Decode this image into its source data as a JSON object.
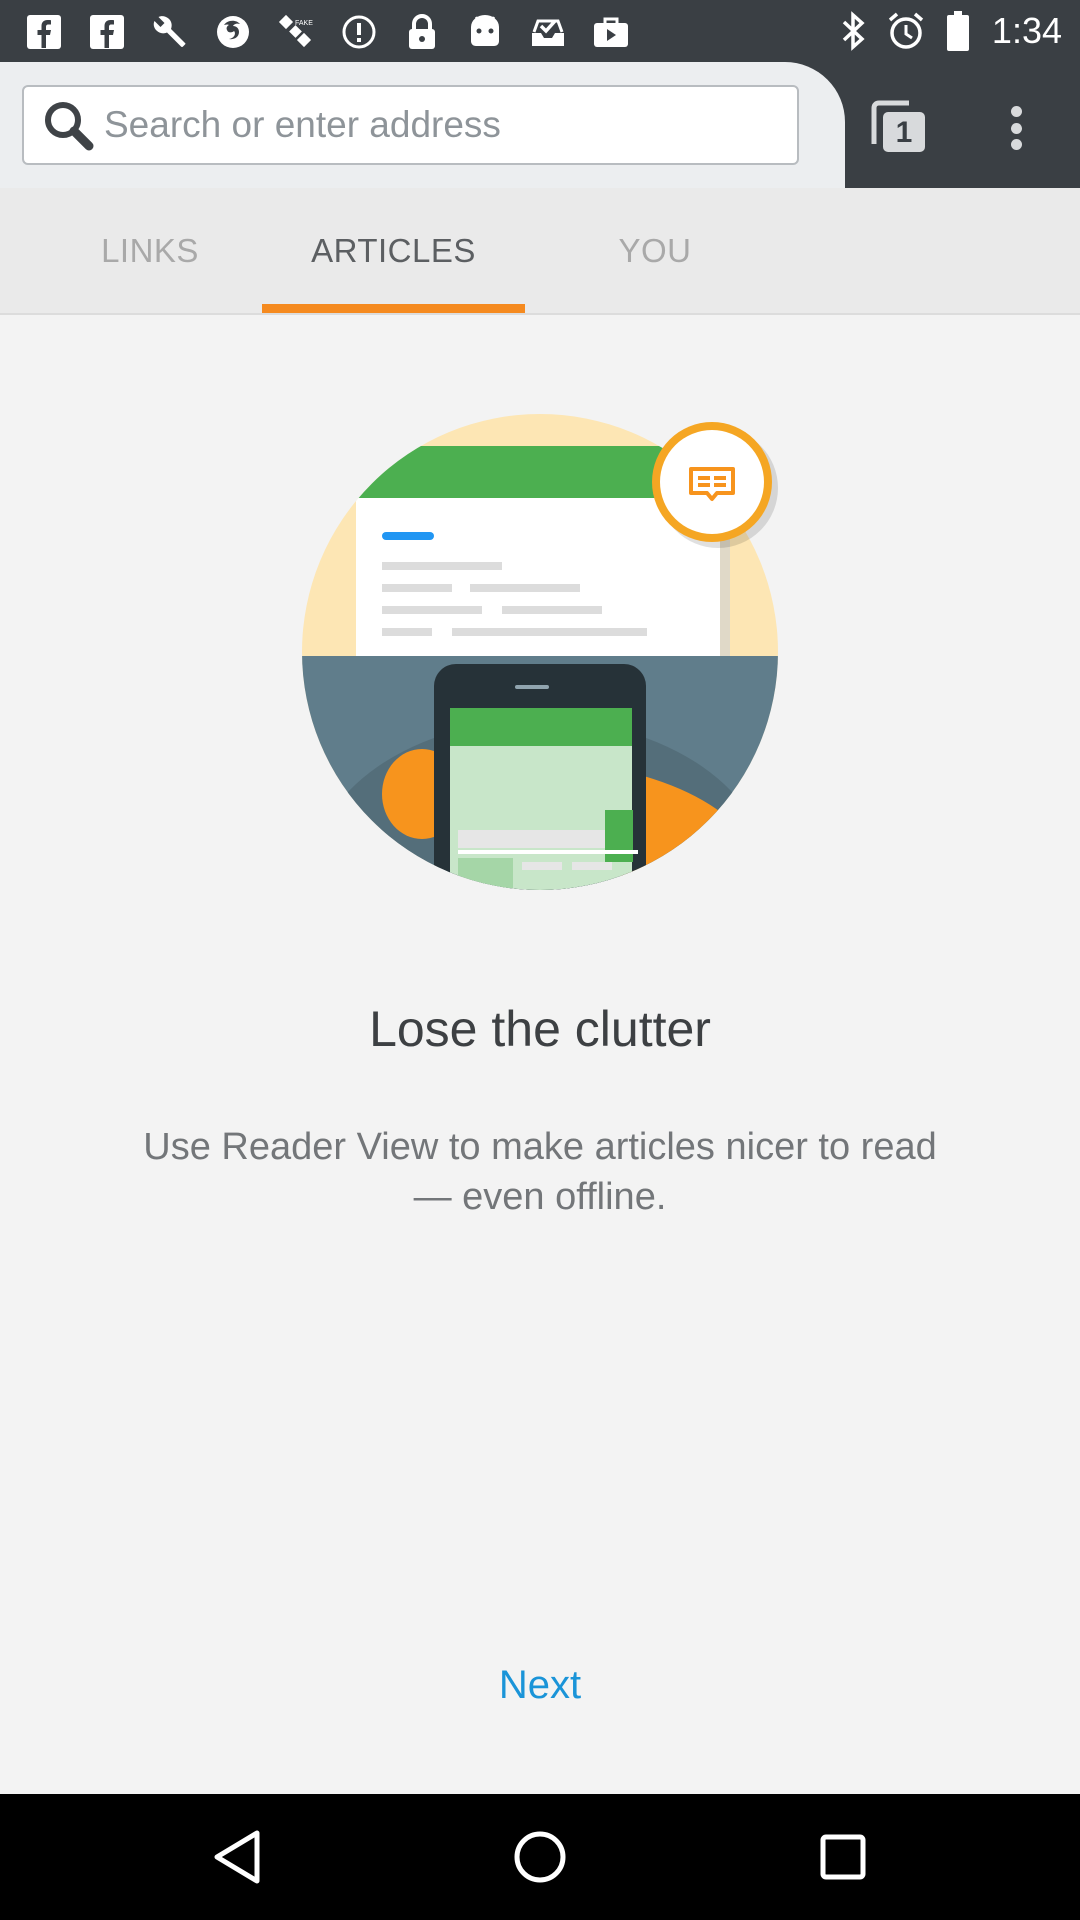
{
  "status_bar": {
    "time": "1:34",
    "notification_icons": [
      "facebook-icon",
      "facebook-icon",
      "wrench-icon",
      "firefox-icon",
      "satellite-icon",
      "alert-icon",
      "lock-icon",
      "android-icon",
      "inbox-check-icon",
      "briefcase-icon"
    ],
    "system_icons": [
      "bluetooth-icon",
      "alarm-icon",
      "battery-icon"
    ]
  },
  "toolbar": {
    "search_placeholder": "Search or enter address",
    "tab_count": "1"
  },
  "panel_tabs": [
    {
      "label": "LINKS",
      "active": false
    },
    {
      "label": "ARTICLES",
      "active": true
    },
    {
      "label": "YOU",
      "active": false
    }
  ],
  "content": {
    "headline": "Lose the clutter",
    "description": "Use Reader View to make articles nicer to read — even offline.",
    "next_label": "Next"
  },
  "colors": {
    "accent_orange": "#f58a1f",
    "link_blue": "#1a94d8",
    "toolbar_dark": "#3a3f44"
  }
}
